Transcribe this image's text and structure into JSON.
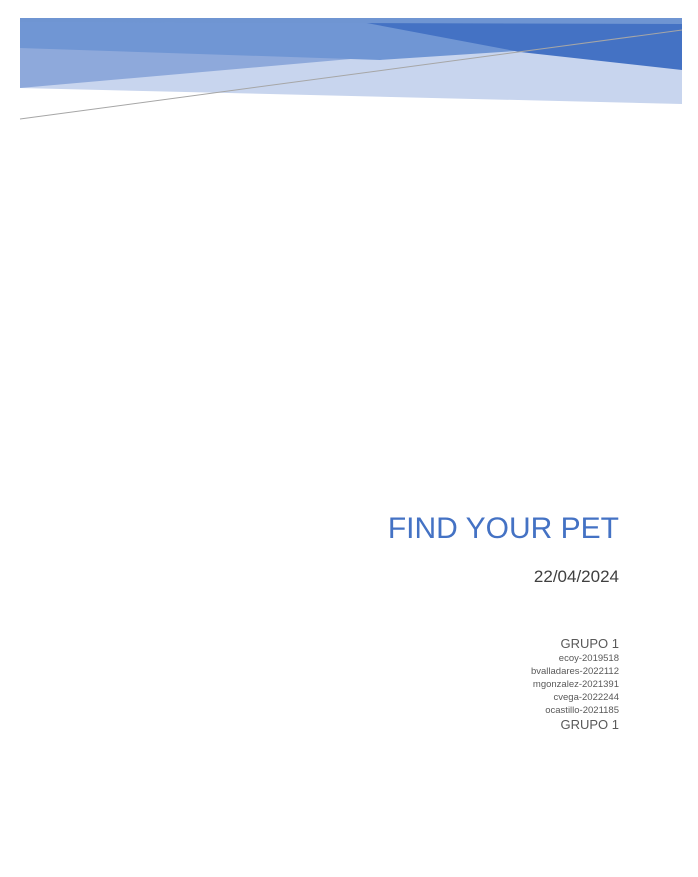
{
  "document": {
    "title": "FIND YOUR PET",
    "date": "22/04/2024",
    "group_label_top": "GRUPO 1",
    "members": [
      "ecoy-2019518",
      "bvalladares-2022112",
      "mgonzalez-2021391",
      "cvega-2022244",
      "ocastillo-2021185"
    ],
    "group_label_bottom": "GRUPO 1"
  },
  "colors": {
    "accent": "#4472C4",
    "text": "#404040",
    "muted": "#595959"
  }
}
